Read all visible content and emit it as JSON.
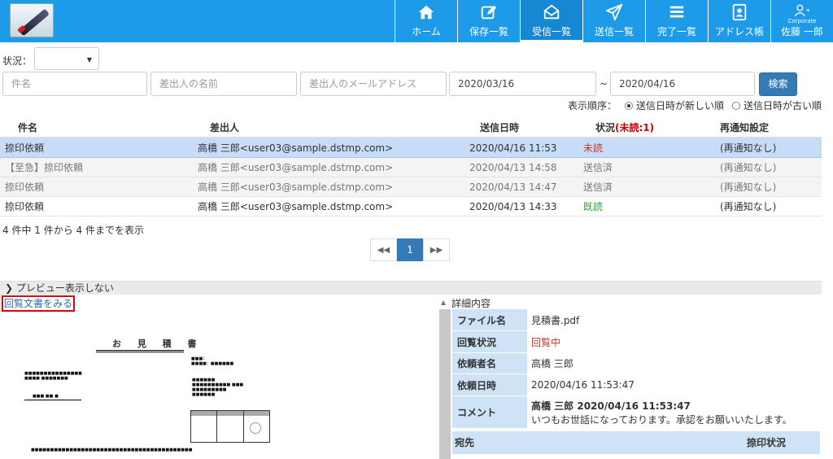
{
  "nav": {
    "items": [
      {
        "label": "ホーム",
        "icon": "home-icon"
      },
      {
        "label": "保存一覧",
        "icon": "edit-icon"
      },
      {
        "label": "受信一覧",
        "icon": "inbox-icon",
        "active": true
      },
      {
        "label": "送信一覧",
        "icon": "send-icon"
      },
      {
        "label": "完了一覧",
        "icon": "list-icon"
      },
      {
        "label": "アドレス帳",
        "icon": "address-book-icon"
      }
    ],
    "user": {
      "corp": "Corporate",
      "name": "佐藤 一郎"
    }
  },
  "filters": {
    "status_label": "状況：",
    "status_value": "",
    "subject_placeholder": "件名",
    "sender_name_placeholder": "差出人の名前",
    "sender_email_placeholder": "差出人のメールアドレス",
    "date_from": "2020/03/16",
    "range_sep": "~",
    "date_to": "2020/04/16",
    "search_label": "検索"
  },
  "sort": {
    "label": "表示順序：",
    "option_new": "送信日時が新しい順",
    "option_old": "送信日時が古い順"
  },
  "table": {
    "headers": {
      "subject": "件名",
      "sender": "差出人",
      "sent_at": "送信日時",
      "status": "状況",
      "unread": "(未読:1)",
      "renotify": "再通知設定"
    },
    "rows": [
      {
        "subject": "捺印依頼",
        "sender": "高橋 三郎<user03@sample.dstmp.com>",
        "sent_at": "2020/04/16 11:53",
        "status": "未読",
        "renotify": "(再通知なし)"
      },
      {
        "subject": "【至急】捺印依頼",
        "sender": "高橋 三郎<user03@sample.dstmp.com>",
        "sent_at": "2020/04/13 14:58",
        "status": "送信済",
        "renotify": "(再通知なし)"
      },
      {
        "subject": "捺印依頼",
        "sender": "高橋 三郎<user03@sample.dstmp.com>",
        "sent_at": "2020/04/13 14:47",
        "status": "送信済",
        "renotify": "(再通知なし)"
      },
      {
        "subject": "捺印依頼",
        "sender": "高橋 三郎<user03@sample.dstmp.com>",
        "sent_at": "2020/04/13 14:33",
        "status": "既読",
        "renotify": "(再通知なし)"
      }
    ],
    "summary": "4 件中 1 件から 4 件までを表示"
  },
  "pager": {
    "current": "1",
    "prev_icon": "double-left-icon",
    "next_icon": "double-right-icon"
  },
  "preview": {
    "toggle_label": "プレビュー表示しない",
    "view_link": "回覧文書をみる",
    "doc_title": "お 見 積 書"
  },
  "detail": {
    "title": "詳細内容",
    "file_label": "ファイル名",
    "file_value": "見積書.pdf",
    "circ_label": "回覧状況",
    "circ_value": "回覧中",
    "requester_label": "依頼者名",
    "requester_value": "高橋 三郎",
    "date_label": "依頼日時",
    "date_value": "2020/04/16 11:53:47",
    "comment_label": "コメント",
    "comment_header": "高橋 三郎 2020/04/16 11:53:47",
    "comment_body": "いつもお世話になっております。承認をお願いいたします。",
    "dest_label": "宛先",
    "stamp_status_label": "捺印状況"
  }
}
